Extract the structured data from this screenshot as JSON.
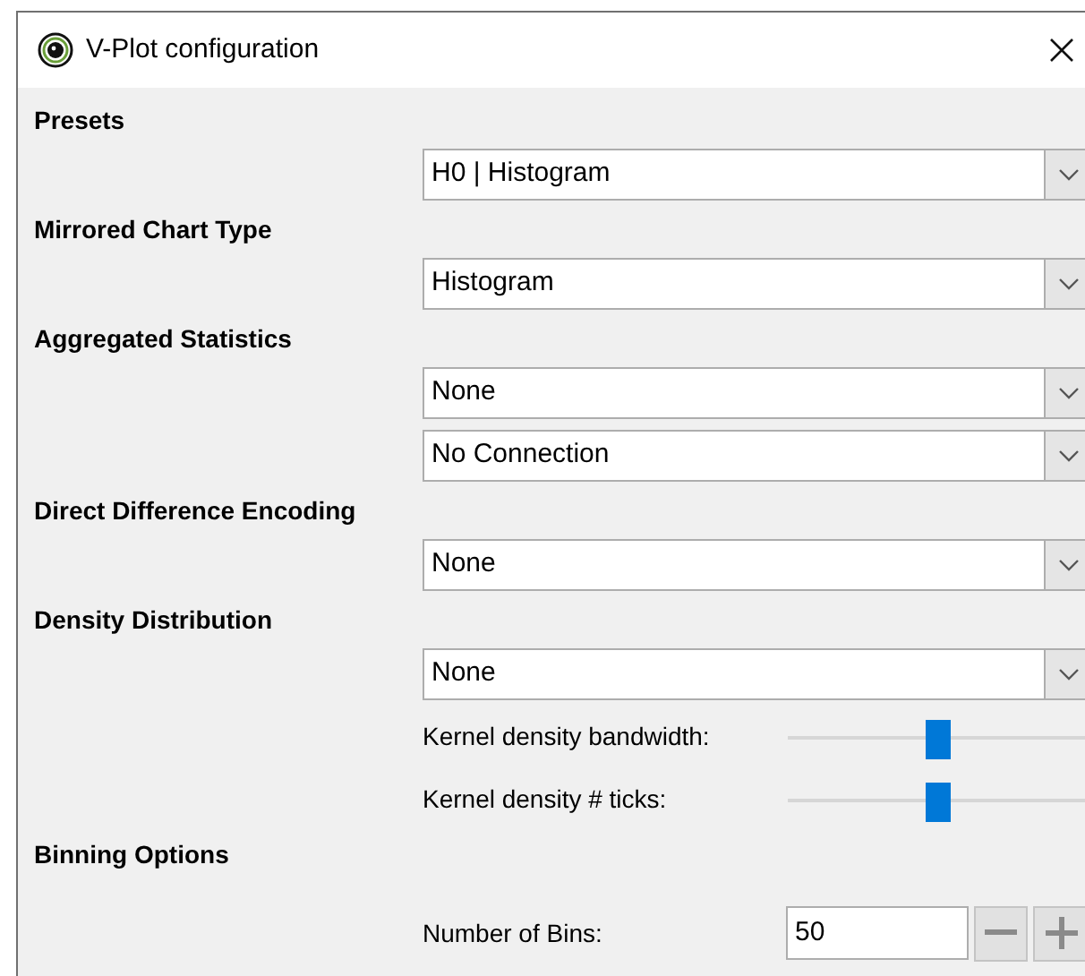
{
  "window": {
    "title": "V-Plot configuration"
  },
  "sections": [
    {
      "heading": "Presets",
      "items": [
        {
          "kind": "dropdown",
          "value": "H0 | Histogram"
        }
      ]
    },
    {
      "heading": "Mirrored Chart Type",
      "items": [
        {
          "kind": "dropdown",
          "value": "Histogram"
        }
      ]
    },
    {
      "heading": "Aggregated Statistics",
      "items": [
        {
          "kind": "dropdown",
          "value": "None"
        },
        {
          "kind": "dropdown",
          "value": "No Connection"
        }
      ]
    },
    {
      "heading": "Direct Difference Encoding",
      "items": [
        {
          "kind": "dropdown",
          "value": "None"
        }
      ]
    },
    {
      "heading": "Density Distribution",
      "items": [
        {
          "kind": "dropdown",
          "value": "None"
        },
        {
          "kind": "slider",
          "label": "Kernel density bandwidth:",
          "level": 0.5
        },
        {
          "kind": "slider",
          "label": "Kernel density # ticks:",
          "level": 0.5
        }
      ]
    },
    {
      "heading": "Binning Options",
      "items": [
        {
          "kind": "number",
          "label": "Number of Bins:",
          "value": "50"
        }
      ]
    }
  ]
}
